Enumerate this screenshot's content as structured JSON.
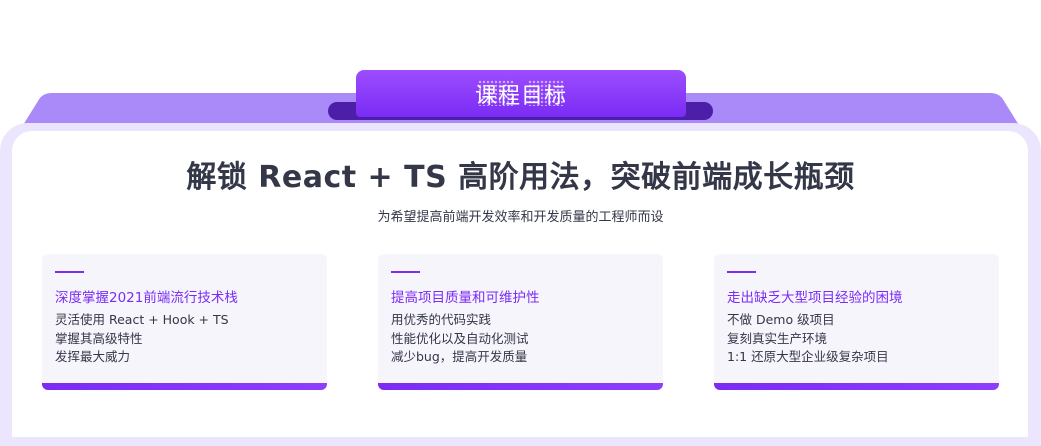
{
  "header": {
    "tab_title": "课程目标"
  },
  "hero": {
    "headline": "解锁 React + TS 高阶用法，突破前端成长瓶颈",
    "subline": "为希望提高前端开发效率和开发质量的工程师而设"
  },
  "features": [
    {
      "title": "深度掌握2021前端流行技术栈",
      "lines": [
        "灵活使用 React + Hook + TS",
        "掌握其高级特性",
        "发挥最大威力"
      ]
    },
    {
      "title": "提高项目质量和可维护性",
      "lines": [
        "用优秀的代码实践",
        "性能优化以及自动化测试",
        "减少bug，提高开发质量"
      ]
    },
    {
      "title": "走出缺乏大型项目经验的困境",
      "lines": [
        "不做 Demo 级项目",
        "复刻真实生产环境",
        "1:1 还原大型企业级复杂项目"
      ]
    }
  ],
  "colors": {
    "accent": "#7a2cf4",
    "band": "#a98af8",
    "frame": "#ebe6fd",
    "text": "#333747"
  }
}
